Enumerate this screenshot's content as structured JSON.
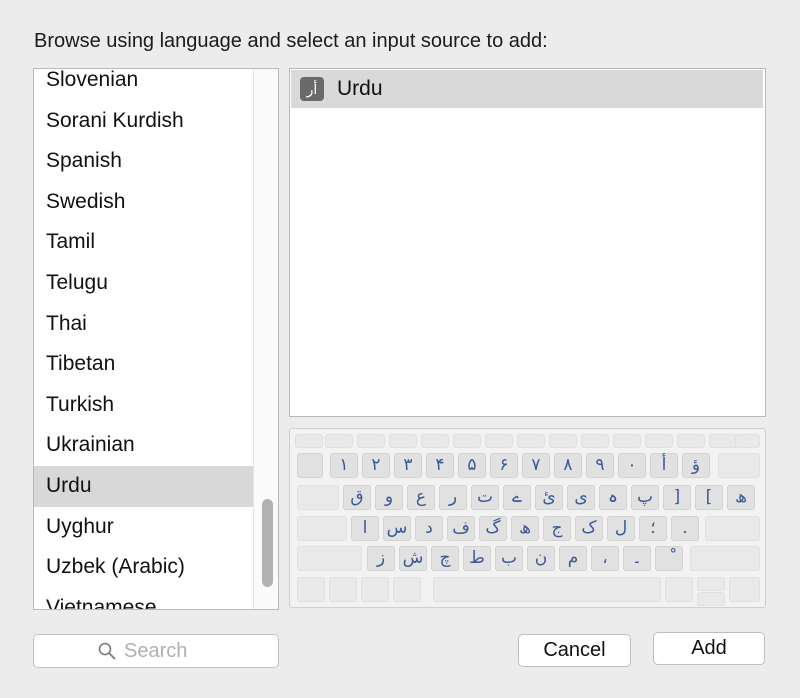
{
  "dialog": {
    "prompt": "Browse using language and select an input source to add:"
  },
  "languages": {
    "items": [
      {
        "label": "Slovenian"
      },
      {
        "label": "Sorani Kurdish"
      },
      {
        "label": "Spanish"
      },
      {
        "label": "Swedish"
      },
      {
        "label": "Tamil"
      },
      {
        "label": "Telugu"
      },
      {
        "label": "Thai"
      },
      {
        "label": "Tibetan"
      },
      {
        "label": "Turkish"
      },
      {
        "label": "Ukrainian"
      },
      {
        "label": "Urdu"
      },
      {
        "label": "Uyghur"
      },
      {
        "label": "Uzbek (Arabic)"
      },
      {
        "label": "Vietnamese"
      }
    ],
    "selected": "Urdu"
  },
  "sources": {
    "items": [
      {
        "label": "Urdu",
        "icon_glyph": "أر",
        "icon": "urdu-input-icon"
      }
    ]
  },
  "keyboard": {
    "row1": [
      "۱",
      "۲",
      "۳",
      "۴",
      "۵",
      "۶",
      "۷",
      "۸",
      "۹",
      "۰",
      "أ",
      "ؤ"
    ],
    "row2": [
      "ق",
      "و",
      "ع",
      "ر",
      "ت",
      "ے",
      "ئ",
      "ی",
      "ہ",
      "پ",
      "]",
      "[",
      "ھ"
    ],
    "row3": [
      "ا",
      "س",
      "د",
      "ف",
      "گ",
      "ھ",
      "ج",
      "ک",
      "ل",
      "؛",
      "."
    ],
    "row4": [
      "ز",
      "ش",
      "چ",
      "ط",
      "ب",
      "ن",
      "م",
      "،",
      "۔",
      "ْ"
    ]
  },
  "search": {
    "placeholder": "Search",
    "value": "",
    "icon": "search-icon"
  },
  "buttons": {
    "cancel": "Cancel",
    "add": "Add"
  }
}
